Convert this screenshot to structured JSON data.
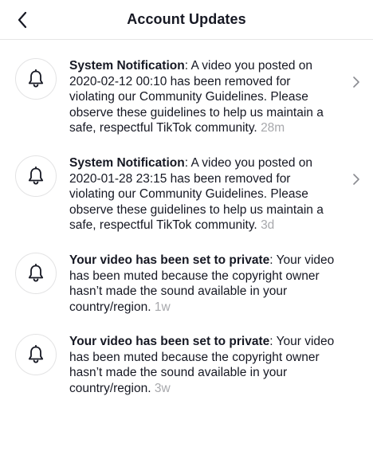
{
  "header": {
    "title": "Account Updates",
    "back_icon": "chevron-left-icon"
  },
  "notifications": [
    {
      "icon": "bell-icon",
      "lead": "System Notification",
      "body": ": A video you posted on 2020-02-12 00:10 has been removed for violating our Community Guidelines. Please observe these guidelines to help us maintain a safe, respectful TikTok community.",
      "time": "28m",
      "has_chevron": true
    },
    {
      "icon": "bell-icon",
      "lead": "System Notification",
      "body": ": A video you posted on 2020-01-28 23:15 has been removed for violating our Community Guidelines. Please observe these guidelines to help us maintain a safe, respectful TikTok community.",
      "time": "3d",
      "has_chevron": true
    },
    {
      "icon": "bell-icon",
      "lead": "Your video has been set to private",
      "body": ": Your video has been muted because the copyright owner hasn’t made the sound available in your country/region.",
      "time": "1w",
      "has_chevron": false
    },
    {
      "icon": "bell-icon",
      "lead": "Your video has been set to private",
      "body": ": Your video has been muted because the copyright owner hasn’t made the sound available in your country/region.",
      "time": "3w",
      "has_chevron": false
    }
  ],
  "colors": {
    "text": "#161823",
    "muted_time": "#a7a8ac",
    "divider": "#e6e6e6"
  }
}
